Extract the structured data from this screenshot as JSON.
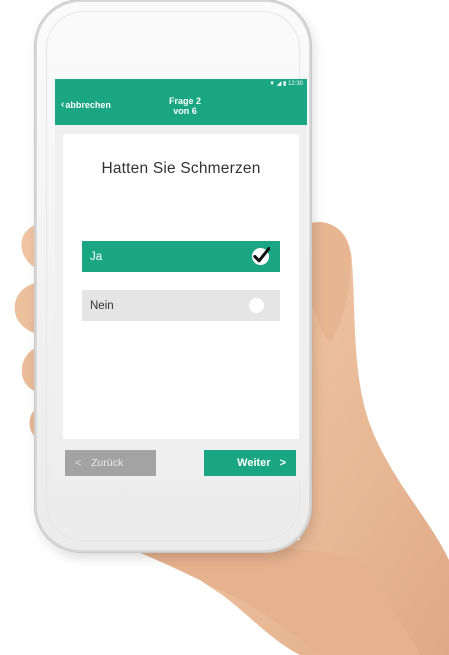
{
  "status_bar": {
    "time": "12:30"
  },
  "header": {
    "cancel_label": "abbrechen",
    "title_line1": "Frage 2",
    "title_line2": "von 6"
  },
  "question": {
    "text": "Hatten Sie Schmerzen"
  },
  "options": [
    {
      "label": "Ja",
      "selected": true
    },
    {
      "label": "Nein",
      "selected": false
    }
  ],
  "footer": {
    "back_label": "Zurück",
    "next_label": "Weiter"
  },
  "colors": {
    "accent": "#1aa583",
    "back_button": "#a3a3a3",
    "option_unselected": "#e5e5e5"
  },
  "icons": {
    "cancel_chevron": "chevron-left-icon",
    "selected_option": "checkmark-icon",
    "unselected_option": "radio-empty-icon",
    "back_button": "chevron-left-icon",
    "next_button": "chevron-right-icon"
  }
}
